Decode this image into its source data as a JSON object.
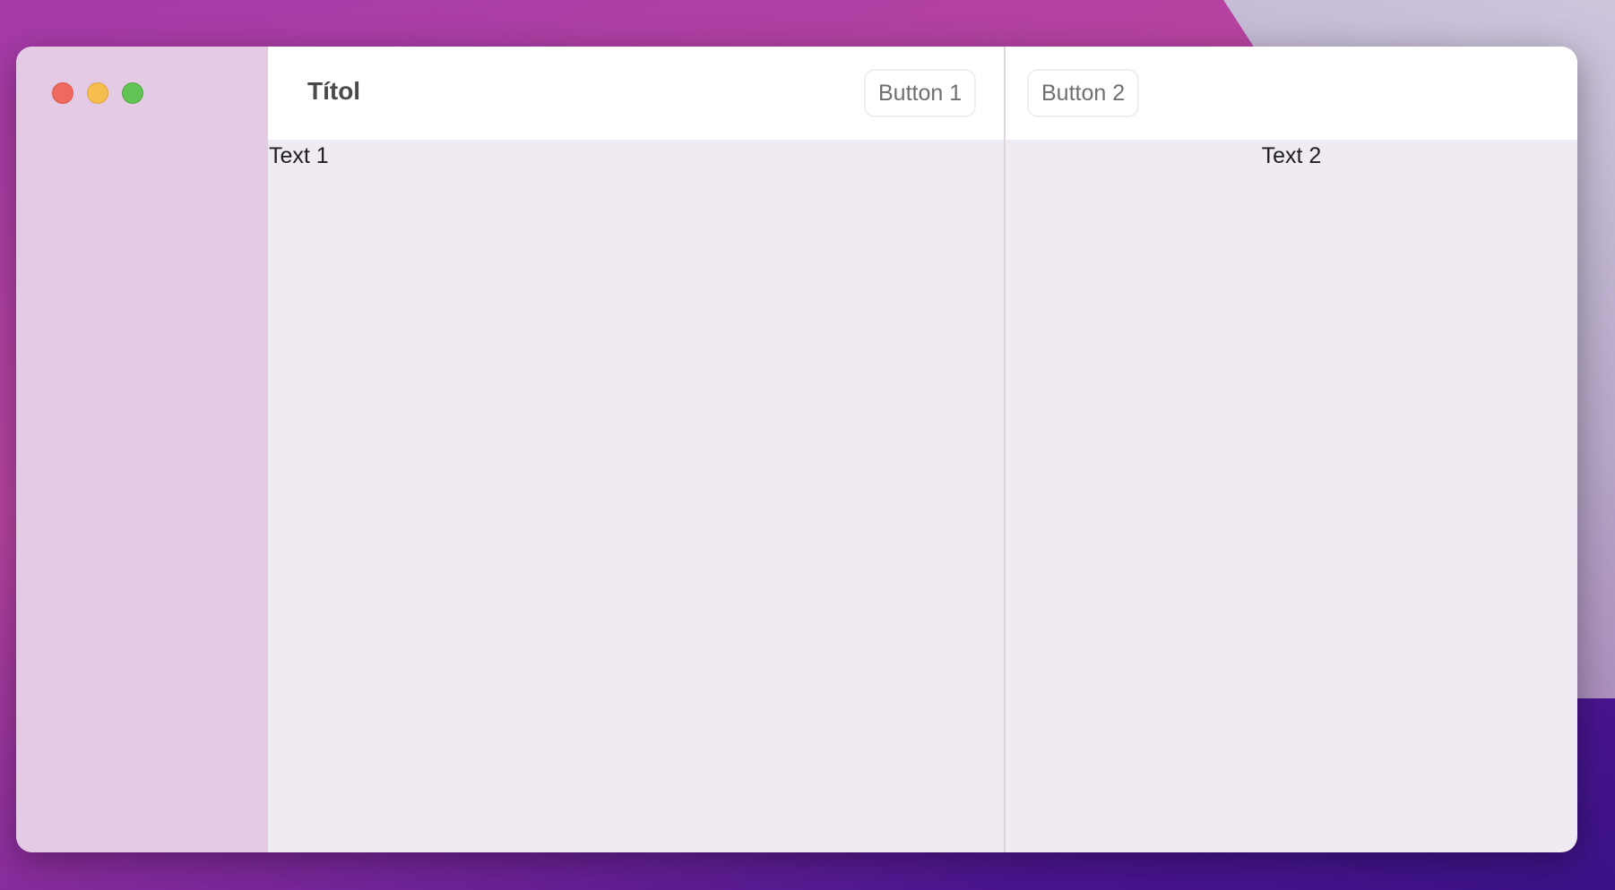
{
  "window": {
    "title": "Títol",
    "traffic_lights": {
      "close": "#ee6a5e",
      "minimize": "#f5be4f",
      "maximize": "#61c454"
    }
  },
  "toolbar": {
    "button1_label": "Button 1",
    "button2_label": "Button 2"
  },
  "content": {
    "text1": "Text 1",
    "text2": "Text 2"
  }
}
